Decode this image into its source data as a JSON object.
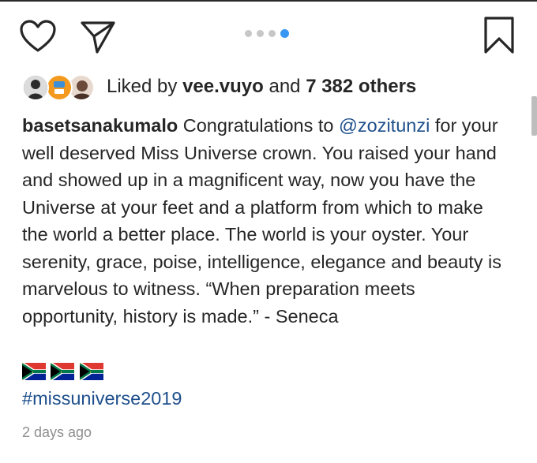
{
  "post": {
    "carousel": {
      "total": 4,
      "active_index": 3
    },
    "likes": {
      "prefix": "Liked by ",
      "user": "vee.vuyo",
      "middle": " and ",
      "count": "7 382 others"
    },
    "caption": {
      "username": "basetsanakumalo",
      "text_before_mention": " Congratulations to ",
      "mention": "@zozitunzi",
      "text_after_mention": " for your well deserved Miss Universe crown. You raised your hand and showed up in a magnificent way, now you have the Universe at your feet and a platform from which to make the world a better place. The world is your oyster. Your serenity, grace, poise, intelligence, elegance and beauty is marvelous to witness. “When preparation meets opportunity, history is made.” - Seneca"
    },
    "flags": [
      "south-africa-flag",
      "south-africa-flag",
      "south-africa-flag"
    ],
    "hashtag": "#missuniverse2019",
    "timestamp": "2 days ago"
  },
  "icons": {
    "like": "heart-icon",
    "share": "paper-plane-icon",
    "save": "bookmark-icon"
  },
  "colors": {
    "text": "#262626",
    "link": "#1e4f8c",
    "carousel_active": "#3897f0",
    "carousel_inactive": "#c7c7c7",
    "timestamp": "#8e8e8e"
  }
}
